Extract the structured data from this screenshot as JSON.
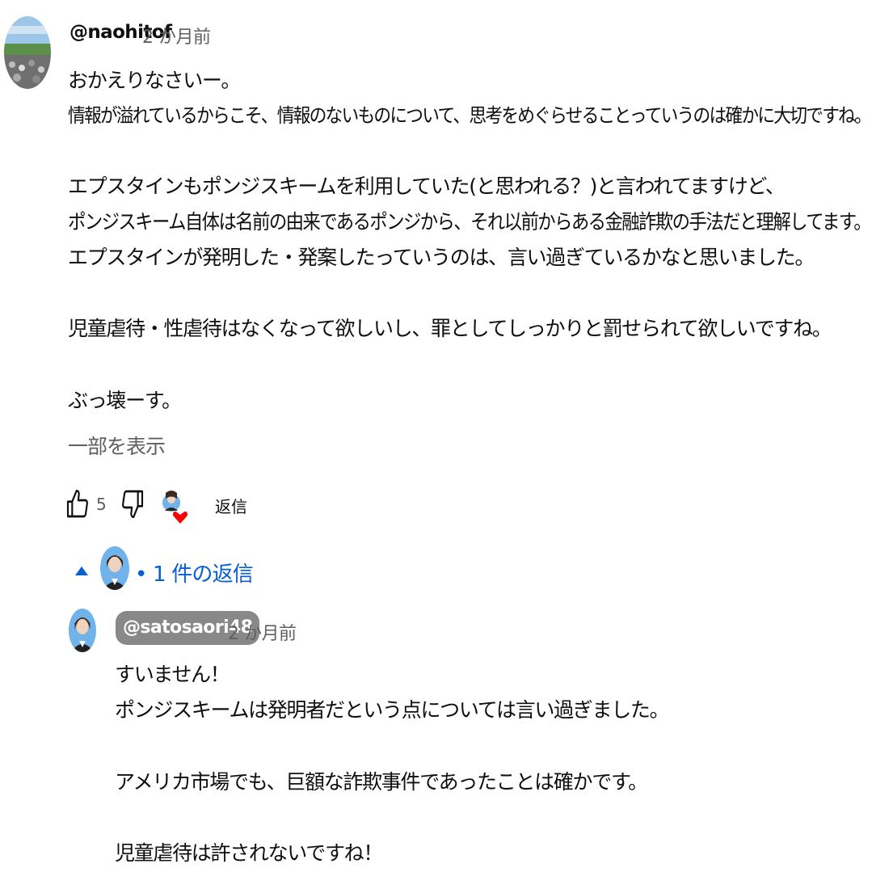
{
  "comment": {
    "author": "@naohitof",
    "time": "2 か月前",
    "lines": [
      "おかえりなさいー。",
      "情報が溢れているからこそ、情報のないものについて、思考をめぐらせることっていうのは確かに大切ですね。",
      "",
      "エプスタインもポンジスキームを利用していた(と思われる？)と言われてますけど、",
      "ポンジスキーム自体は名前の由来であるポンジから、それ以前からある金融詐欺の手法だと理解してます。",
      "エプスタインが発明した・発案したっていうのは、言い過ぎているかなと思いました。",
      "",
      "児童虐待・性虐待はなくなって欲しいし、罪としてしっかりと罰せられて欲しいですね。",
      "",
      "ぶっ壊ーす。"
    ],
    "show_more": "一部を表示",
    "like_count": "5",
    "reply_label": "返信"
  },
  "replies_toggle": {
    "label": "• 1 件の返信"
  },
  "reply": {
    "author": "@satosaori48",
    "time": "2 か月前",
    "lines": [
      "すいません！",
      "ポンジスキームは発明者だという点については言い過ぎました。",
      "",
      "アメリカ市場でも、巨額な詐欺事件であったことは確かです。",
      "",
      "児童虐待は許されないですね！"
    ]
  },
  "colors": {
    "link_blue": "#065fd4",
    "secondary_text": "#606060",
    "heart": "#ff0000",
    "chip_bg": "#888888"
  }
}
